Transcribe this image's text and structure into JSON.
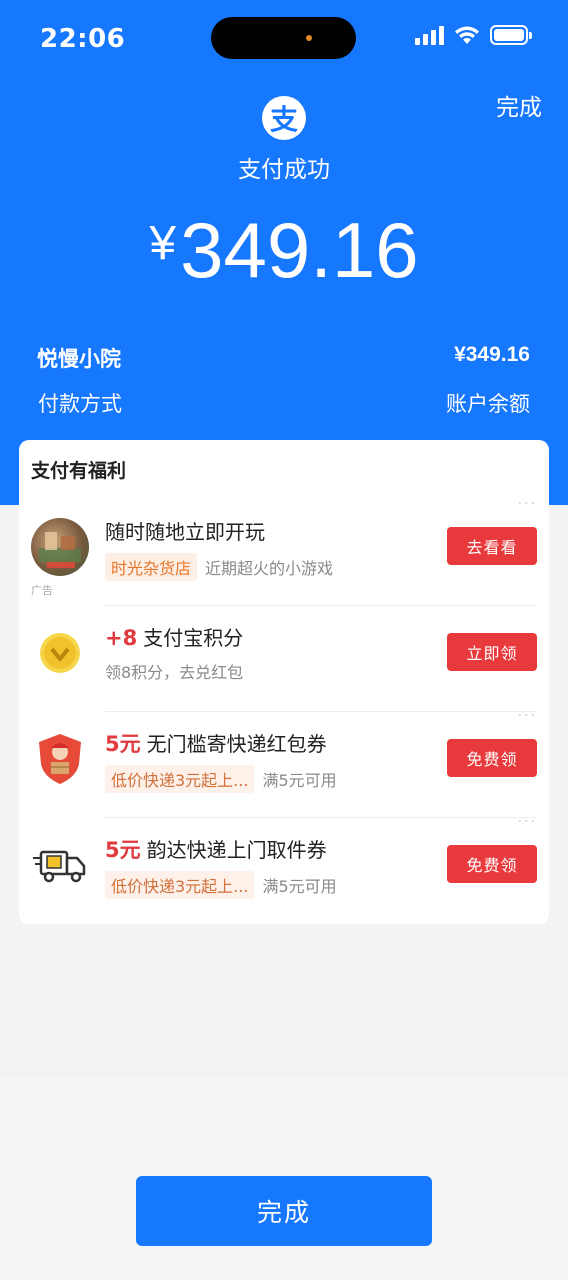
{
  "status_bar": {
    "time": "22:06"
  },
  "header": {
    "done_label": "完成",
    "logo_glyph": "支",
    "status_text": "支付成功",
    "currency_symbol": "¥",
    "amount": "349.16"
  },
  "summary": {
    "merchant": "悦慢小院",
    "merchant_amount": "¥349.16",
    "payment_method_label": "付款方式",
    "payment_method_value": "账户余额"
  },
  "benefits": {
    "title": "支付有福利",
    "items": [
      {
        "icon": "game-thumbnail-icon",
        "title_prefix": "",
        "title": "随时随地立即开玩",
        "tag": "时光杂货店",
        "sub": "近期超火的小游戏",
        "ad_label": "广告",
        "button": "去看看"
      },
      {
        "icon": "points-coin-icon",
        "title_prefix": "+8",
        "title": "支付宝积分",
        "tag": "",
        "sub": "领8积分，去兑红包",
        "button": "立即领"
      },
      {
        "icon": "courier-shield-icon",
        "title_prefix": "5元",
        "title": "无门槛寄快递红包券",
        "tag": "低价快递3元起上...",
        "sub": "满5元可用",
        "button": "免费领"
      },
      {
        "icon": "delivery-truck-icon",
        "title_prefix": "5元",
        "title": "韵达快递上门取件券",
        "tag": "低价快递3元起上...",
        "sub": "满5元可用",
        "button": "免费领"
      }
    ]
  },
  "footer": {
    "done_label": "完成"
  },
  "colors": {
    "brand_blue": "#1677ff",
    "action_red": "#e8393c",
    "tag_orange": "#e9772b"
  }
}
